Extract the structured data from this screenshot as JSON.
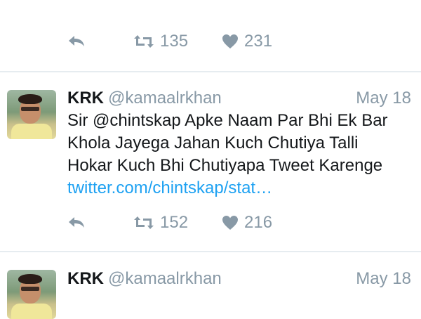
{
  "top_partial": {
    "faded_text": "",
    "actions": {
      "retweets": "135",
      "likes": "231"
    }
  },
  "tweets": [
    {
      "name": "KRK",
      "handle": "@kamaalrkhan",
      "date": "May 18",
      "lines": [
        "Sir @chintskap Apke Naam Par Bhi Ek Bar",
        "Khola Jayega Jahan Kuch Chutiya Talli",
        "Hokar Kuch Bhi Chutiyapa Tweet Karenge"
      ],
      "link": "twitter.com/chintskap/stat…",
      "actions": {
        "retweets": "152",
        "likes": "216"
      }
    },
    {
      "name": "KRK",
      "handle": "@kamaalrkhan",
      "date": "May 18"
    }
  ],
  "icons": {
    "reply": "reply-icon",
    "retweet": "retweet-icon",
    "like": "heart-icon"
  },
  "colors": {
    "link": "#1da1f2",
    "muted": "#8899a6",
    "divider": "#e6ecf0"
  }
}
